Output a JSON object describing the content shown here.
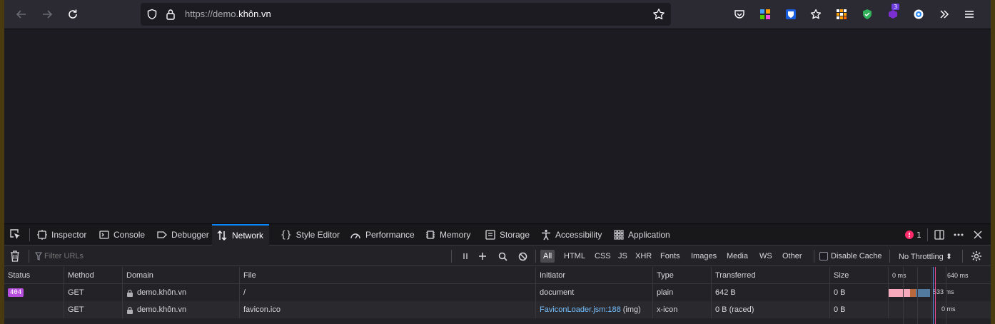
{
  "browser": {
    "url_prefix": "https://demo.",
    "url_host": "khôn.vn",
    "extension_badge": "3"
  },
  "devtools": {
    "tabs": [
      {
        "label": "Inspector"
      },
      {
        "label": "Console"
      },
      {
        "label": "Debugger"
      },
      {
        "label": "Network"
      },
      {
        "label": "Style Editor"
      },
      {
        "label": "Performance"
      },
      {
        "label": "Memory"
      },
      {
        "label": "Storage"
      },
      {
        "label": "Accessibility"
      },
      {
        "label": "Application"
      }
    ],
    "active_tab": "Network",
    "error_count": "1"
  },
  "network": {
    "filter_placeholder": "Filter URLs",
    "type_filters": [
      "All",
      "HTML",
      "CSS",
      "JS",
      "XHR",
      "Fonts",
      "Images",
      "Media",
      "WS",
      "Other"
    ],
    "active_filter": "All",
    "disable_cache_label": "Disable Cache",
    "throttling_label": "No Throttling ⬍",
    "columns": {
      "status": "Status",
      "method": "Method",
      "domain": "Domain",
      "file": "File",
      "initiator": "Initiator",
      "type": "Type",
      "transferred": "Transferred",
      "size": "Size"
    },
    "waterfall_ticks": {
      "start": "0 ms",
      "end": "640 ms"
    },
    "requests": [
      {
        "status": "404",
        "method": "GET",
        "domain": "demo.khôn.vn",
        "file": "/",
        "initiator": "document",
        "initiator_link": "",
        "initiator_suffix": "",
        "type": "plain",
        "transferred": "642 B",
        "size": "0 B",
        "timing": "533 ms"
      },
      {
        "status": "",
        "method": "GET",
        "domain": "demo.khôn.vn",
        "file": "favicon.ico",
        "initiator": "",
        "initiator_link": "FaviconLoader.jsm:188",
        "initiator_suffix": " (img)",
        "type": "x-icon",
        "transferred": "0 B (raced)",
        "size": "0 B",
        "timing": "0 ms"
      }
    ]
  },
  "colors": {
    "accent": "#0a84ff",
    "status_404": "#b84ee0",
    "link": "#75bfff"
  }
}
